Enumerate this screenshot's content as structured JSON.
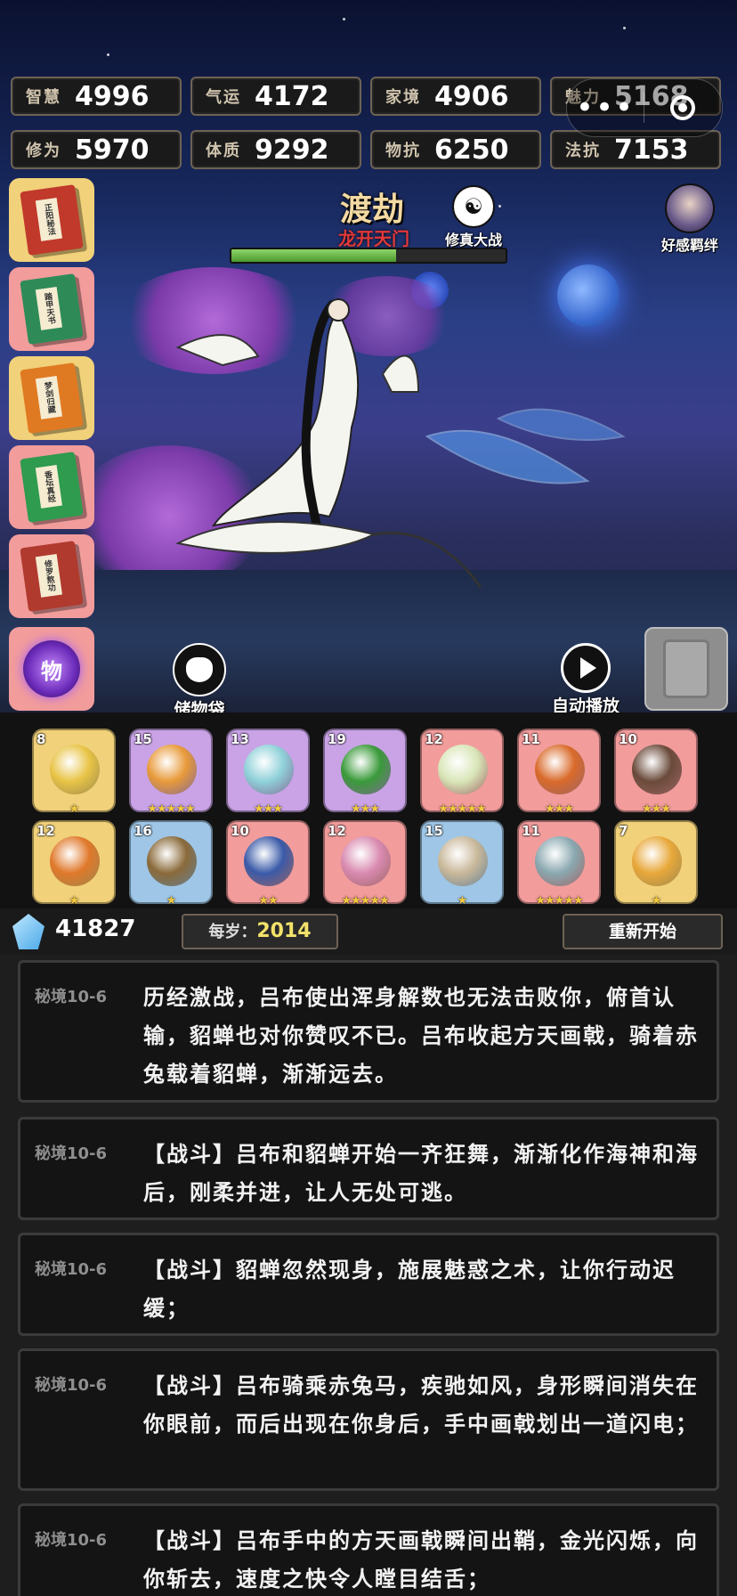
{
  "stats": [
    {
      "label": "智慧",
      "value": "4996"
    },
    {
      "label": "气运",
      "value": "4172"
    },
    {
      "label": "家境",
      "value": "4906"
    },
    {
      "label": "魅力",
      "value": "5168"
    },
    {
      "label": "修为",
      "value": "5970"
    },
    {
      "label": "体质",
      "value": "9292"
    },
    {
      "label": "物抗",
      "value": "6250"
    },
    {
      "label": "法抗",
      "value": "7153"
    }
  ],
  "stage": {
    "title": "渡劫",
    "subtitle": "龙开天门",
    "progress": 0.6
  },
  "header_buttons": {
    "battle": "修真大战",
    "affection": "好感羁绊"
  },
  "books": [
    {
      "label": "正阳秘法",
      "color": "#c0392b",
      "bg": "#f1d17a"
    },
    {
      "label": "踏甲天书",
      "color": "#2e8b57",
      "bg": "#f29c9c"
    },
    {
      "label": "梦剑归藏",
      "color": "#e07a22",
      "bg": "#f1d17a"
    },
    {
      "label": "香坛真经",
      "color": "#2e9b4f",
      "bg": "#f29c9c"
    },
    {
      "label": "修罗熬功",
      "color": "#b03a2e",
      "bg": "#f29c9c"
    }
  ],
  "item_bag_badge": "物",
  "bag_label": "储物袋",
  "autoplay_label": "自动播放",
  "items": [
    {
      "level": "8",
      "stars": "★",
      "bg": "#f1d17a",
      "color": "#e8c446"
    },
    {
      "level": "15",
      "stars": "★★★★★",
      "bg": "#c9a3e6",
      "color": "#e89a3a"
    },
    {
      "level": "13",
      "stars": "★★★",
      "bg": "#c9a3e6",
      "color": "#8fd1d9"
    },
    {
      "level": "19",
      "stars": "★★★",
      "bg": "#c9a3e6",
      "color": "#3a9a3a"
    },
    {
      "level": "12",
      "stars": "★★★★★",
      "bg": "#f29c9c",
      "color": "#d9e6b8"
    },
    {
      "level": "11",
      "stars": "★★★",
      "bg": "#f29c9c",
      "color": "#d96a2a"
    },
    {
      "level": "10",
      "stars": "★★★",
      "bg": "#f29c9c",
      "color": "#6a4a3a"
    },
    {
      "level": "12",
      "stars": "★",
      "bg": "#f1d17a",
      "color": "#e0782a"
    },
    {
      "level": "16",
      "stars": "★",
      "bg": "#9fc6e6",
      "color": "#8a6a3a"
    },
    {
      "level": "10",
      "stars": "★★",
      "bg": "#f29c9c",
      "color": "#3a5aa8"
    },
    {
      "level": "12",
      "stars": "★★★★★",
      "bg": "#f29c9c",
      "color": "#d98ab0"
    },
    {
      "level": "15",
      "stars": "★",
      "bg": "#9fc6e6",
      "color": "#c9b89a"
    },
    {
      "level": "11",
      "stars": "★★★★★",
      "bg": "#f29c9c",
      "color": "#8aa8b0"
    },
    {
      "level": "7",
      "stars": "★",
      "bg": "#f1d17a",
      "color": "#e8a83a"
    }
  ],
  "currency": {
    "value": "41827"
  },
  "age": {
    "label": "每岁：",
    "value": "2014"
  },
  "restart_label": "重新开始",
  "logs": [
    {
      "tag": "秘境10-6",
      "text": "历经激战，吕布使出浑身解数也无法击败你，俯首认输，貂蝉也对你赞叹不已。吕布收起方天画戟，骑着赤兔载着貂蝉，渐渐远去。"
    },
    {
      "tag": "秘境10-6",
      "text": "【战斗】吕布和貂蝉开始一齐狂舞，渐渐化作海神和海后，刚柔并进，让人无处可逃。"
    },
    {
      "tag": "秘境10-6",
      "text": "【战斗】貂蝉忽然现身，施展魅惑之术，让你行动迟缓；"
    },
    {
      "tag": "秘境10-6",
      "text": "【战斗】吕布骑乘赤兔马，疾驰如风，身形瞬间消失在你眼前，而后出现在你身后，手中画戟划出一道闪电；"
    },
    {
      "tag": "秘境10-6",
      "text": "【战斗】吕布手中的方天画戟瞬间出鞘，金光闪烁，向你斩去，速度之快令人瞠目结舌；"
    }
  ]
}
